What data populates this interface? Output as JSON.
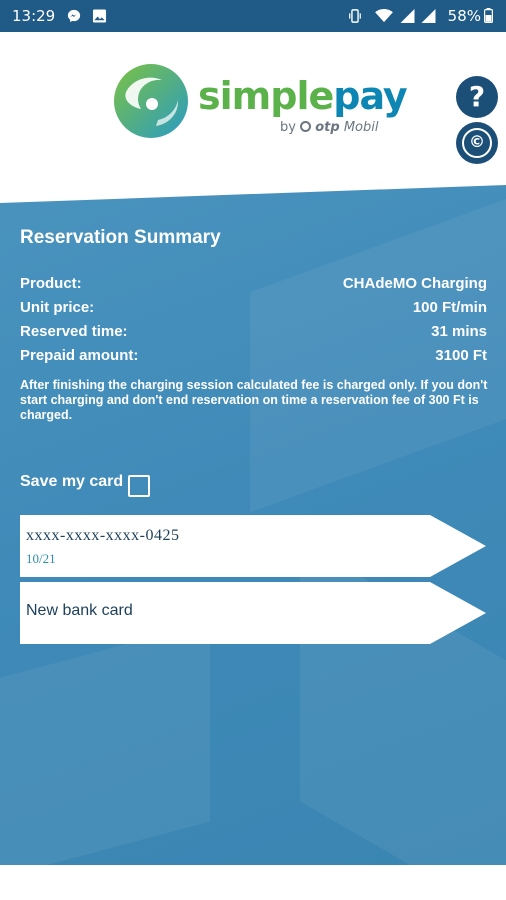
{
  "status_bar": {
    "time": "13:29",
    "battery": "58%",
    "left_icons": [
      "messenger-icon",
      "image-icon"
    ],
    "right_icons": [
      "vibrate-icon",
      "wifi-icon",
      "signal-icon",
      "signal-icon",
      "battery-icon"
    ]
  },
  "header": {
    "logo": {
      "word_simple": "simple",
      "word_pay": "pay",
      "byline_prefix": "by",
      "byline_brand": "otp",
      "byline_suffix": "Mobil"
    },
    "help_label": "?",
    "copyright_label": "©"
  },
  "summary": {
    "title": "Reservation Summary",
    "rows": [
      {
        "label": "Product:",
        "value": "CHAdeMO Charging"
      },
      {
        "label": "Unit price:",
        "value": "100 Ft/min"
      },
      {
        "label": "Reserved time:",
        "value": "31 mins"
      },
      {
        "label": "Prepaid amount:",
        "value": "3100 Ft"
      }
    ],
    "note": "After finishing the charging session calculated fee is charged only. If you don't start charging and don't end reservation on time a reservation fee of 300 Ft is charged."
  },
  "save_card": {
    "label": "Save my card",
    "checked": false
  },
  "cards": {
    "saved": {
      "number": "xxxx-xxxx-xxxx-0425",
      "expiry": "10/21"
    },
    "new_label": "New bank card"
  },
  "colors": {
    "status_bar": "#1f5b86",
    "panel": "#4a93bf",
    "brand_green": "#5bb14a",
    "brand_blue": "#0e86b4",
    "button_dark": "#1c4f78"
  }
}
